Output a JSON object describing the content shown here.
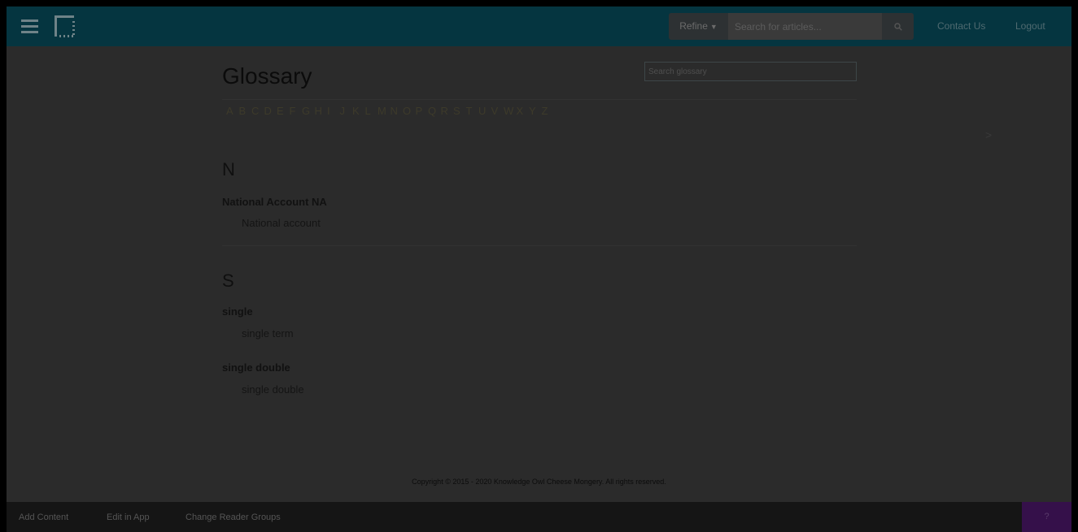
{
  "topbar": {
    "refine_label": "Refine",
    "search_placeholder": "Search for articles...",
    "contact_label": "Contact Us",
    "logout_label": "Logout"
  },
  "main": {
    "title": "Glossary",
    "glossary_search_placeholder": "Search glossary",
    "letters": [
      "A",
      "B",
      "C",
      "D",
      "E",
      "F",
      "G",
      "H",
      "I",
      "J",
      "K",
      "L",
      "M",
      "N",
      "O",
      "P",
      "Q",
      "R",
      "S",
      "T",
      "U",
      "V",
      "W",
      "X",
      "Y",
      "Z"
    ],
    "next_arrow": ">",
    "sections": [
      {
        "letter": "N",
        "entries": [
          {
            "term": "National Account NA",
            "definition": "National account"
          }
        ]
      },
      {
        "letter": "S",
        "entries": [
          {
            "term": "single",
            "definition": "single term"
          },
          {
            "term": "single double",
            "definition": "single double"
          }
        ]
      }
    ]
  },
  "footer": {
    "copyright": "Copyright © 2015 - 2020 Knowledge Owl Cheese Mongery. All rights reserved."
  },
  "bottombar": {
    "add_content": "Add Content",
    "edit_in_app": "Edit in App",
    "change_reader_groups": "Change Reader Groups",
    "help_label": "?"
  }
}
